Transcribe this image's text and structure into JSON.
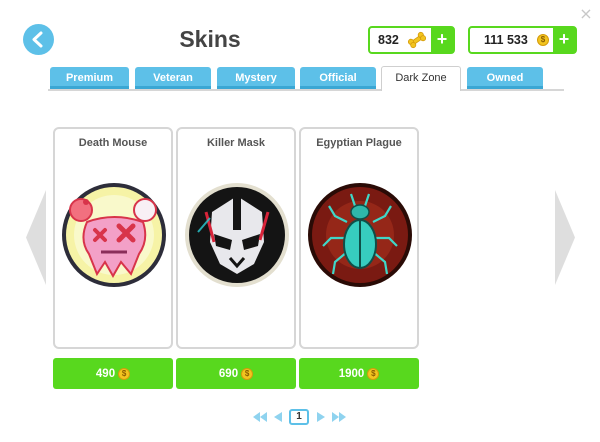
{
  "header": {
    "title": "Skins",
    "close_symbol": "×",
    "currencies": [
      {
        "value": "832",
        "icon": "bone-icon"
      },
      {
        "value": "111 533",
        "icon": "coin-icon"
      }
    ],
    "plus_label": "+"
  },
  "tabs": [
    {
      "label": "Premium",
      "active": false
    },
    {
      "label": "Veteran",
      "active": false
    },
    {
      "label": "Mystery",
      "active": false
    },
    {
      "label": "Official",
      "active": false
    },
    {
      "label": "Dark Zone",
      "active": true
    },
    {
      "label": "Owned",
      "active": false
    }
  ],
  "skins": [
    {
      "name": "Death Mouse",
      "price": "490"
    },
    {
      "name": "Killer Mask",
      "price": "690"
    },
    {
      "name": "Egyptian Plague",
      "price": "1900"
    }
  ],
  "pagination": {
    "current_page": "1"
  },
  "colors": {
    "accent_blue": "#5dc0e8",
    "buy_green": "#58d81e",
    "coin_gold": "#f2c41f"
  }
}
